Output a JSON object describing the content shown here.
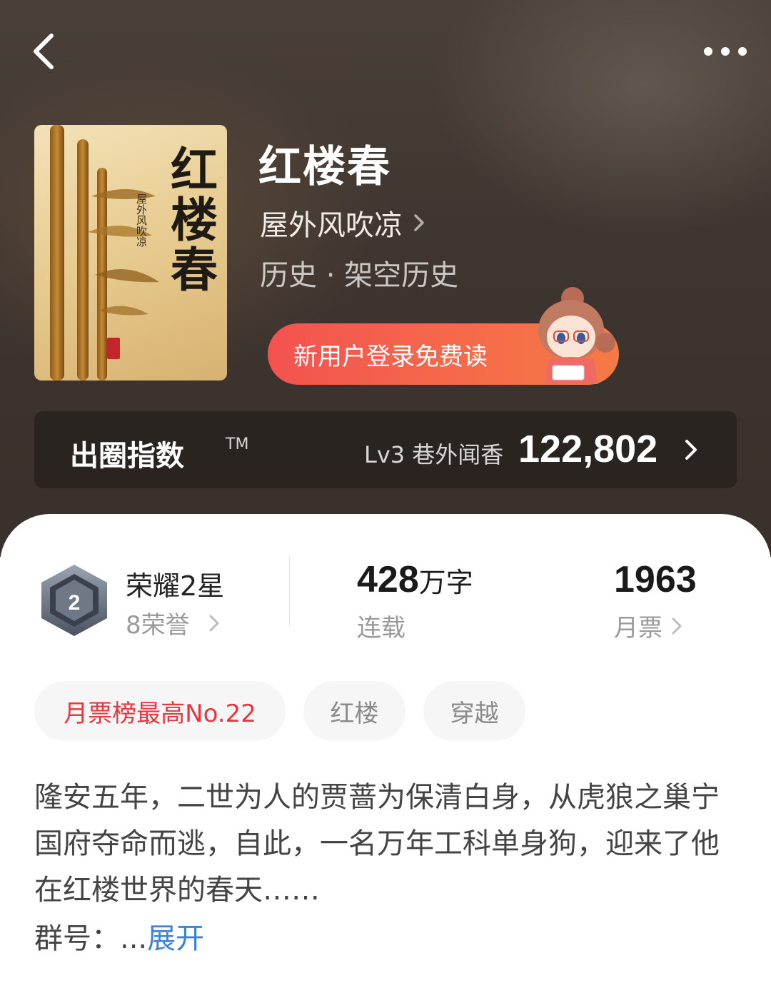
{
  "header": {
    "back_icon": "chevron-left-icon",
    "more_icon": "more-dots-icon"
  },
  "book": {
    "cover": {
      "title": "红楼春",
      "author": "屋外风吹凉"
    },
    "title": "红楼春",
    "author": "屋外风吹凉",
    "genre": "历史 · 架空历史"
  },
  "promo": {
    "label": "新用户登录免费读"
  },
  "index": {
    "label": "出圈指数",
    "tm": "TM",
    "level": "Lv3 巷外闻香",
    "value": "122,802"
  },
  "stats": {
    "honor_title": "荣耀2星",
    "honor_count": "8荣誉",
    "words_num": "428",
    "words_unit": "万字",
    "words_status": "连载",
    "tickets_num": "1963",
    "tickets_label": "月票"
  },
  "tags": [
    "月票榜最高No.22",
    "红楼",
    "穿越"
  ],
  "synopsis": {
    "text": "隆安五年，二世为人的贾蔷为保清白身，从虎狼之巢宁国府夺命而逃，自此，一名万年工科单身狗，迎来了他在红楼世界的春天……",
    "group_label": "群号：",
    "ellipsis": "...",
    "expand": "展开"
  },
  "colors": {
    "accent_red": "#e8383d",
    "promo_gradient_start": "#f4524f",
    "link_blue": "#3b82d8"
  }
}
